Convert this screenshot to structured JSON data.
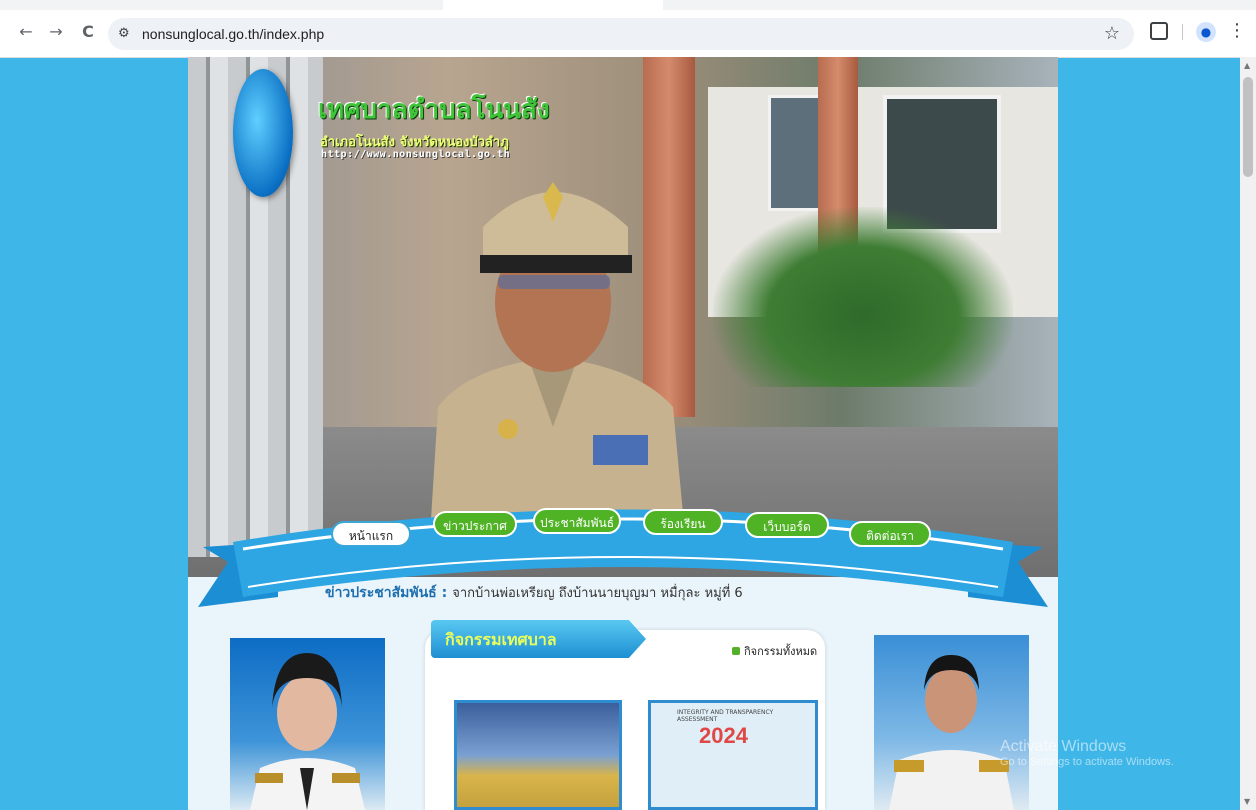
{
  "browser": {
    "url": "nonsunglocal.go.th/index.php",
    "back_icon": "←",
    "forward_icon": "→",
    "reload_icon": "C",
    "site_info_icon": "⚙",
    "star_icon": "☆",
    "menu_icon": "⋮",
    "profile_icon": "●"
  },
  "banner": {
    "title": "เทศบาลตำบลโนนสัง",
    "subtitle": "อำเภอโนนสัง จังหวัดหนองบัวลำภู",
    "url_text": "http://www.nonsunglocal.go.th"
  },
  "nav": {
    "items": [
      {
        "label": "หน้าแรก",
        "active": true
      },
      {
        "label": "ข่าวประกาศ"
      },
      {
        "label": "ประชาสัมพันธ์"
      },
      {
        "label": "ร้องเรียน"
      },
      {
        "label": "เว็บบอร์ด"
      },
      {
        "label": "ติดต่อเรา"
      }
    ]
  },
  "ticker": {
    "label": "ข่าวประชาสัมพันธ์ :",
    "text": "จากบ้านพ่อเหรียญ ถึงบ้านนายบุญมา หมื่กุละ หมู่ที่ 6"
  },
  "activities": {
    "title": "กิจกรรมเทศบาล",
    "all_link": "กิจกรรมทั้งหมด",
    "thumb2_year": "2024",
    "thumb2_caption": "INTEGRITY AND TRANSPARENCY ASSESSMENT"
  },
  "os_watermark": {
    "line1": "Activate Windows",
    "line2": "Go to Settings to activate Windows."
  },
  "colors": {
    "page_bg": "#3fb6e8",
    "nav_green": "#4fb325",
    "ribbon_blue": "#1d8fd1"
  }
}
